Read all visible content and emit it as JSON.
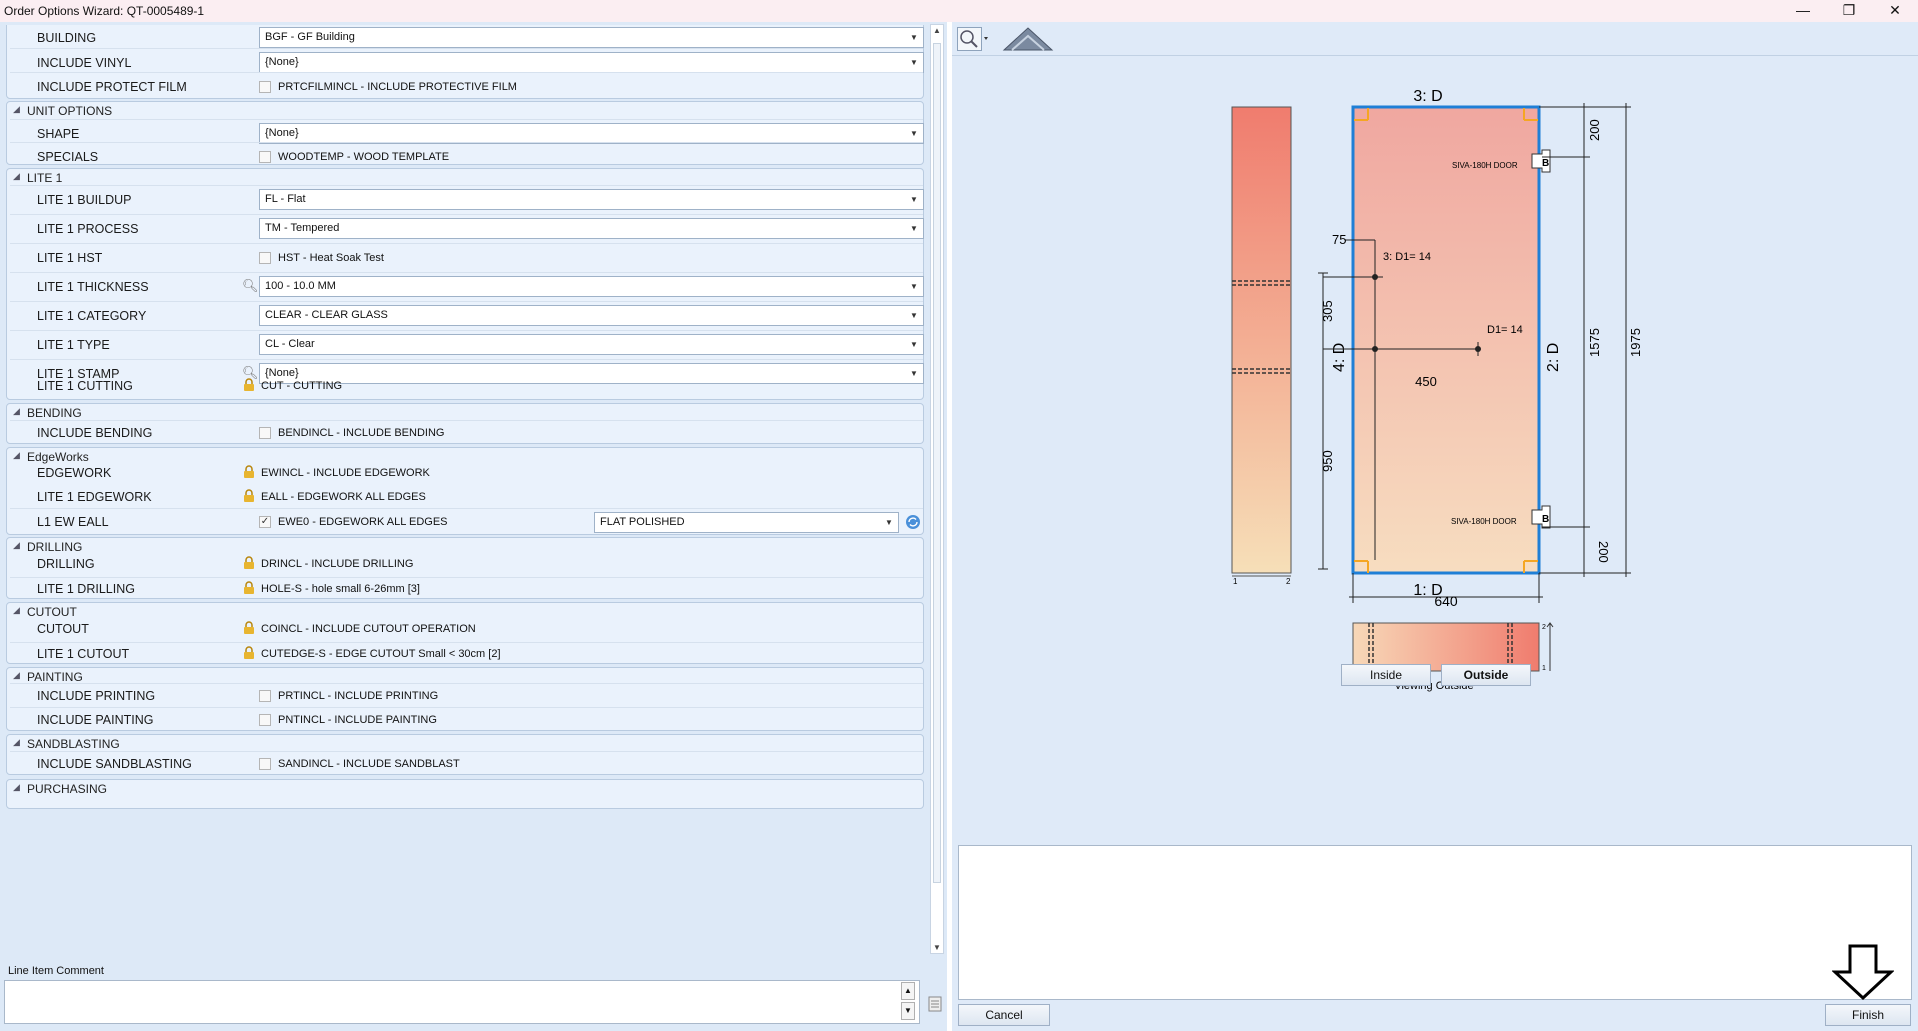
{
  "window": {
    "title": "Order Options Wizard: QT-0005489-1",
    "minimize": "—",
    "maximize": "❐",
    "close": "✕"
  },
  "sections": {
    "unit_options": "UNIT OPTIONS",
    "lite1": "LITE 1",
    "bending": "BENDING",
    "edgeworks": "EdgeWorks",
    "drilling": "DRILLING",
    "cutout": "CUTOUT",
    "painting": "PAINTING",
    "sandblasting": "SANDBLASTING",
    "purchasing": "PURCHASING"
  },
  "rows": {
    "building": {
      "label": "BUILDING",
      "value": "BGF - GF Building"
    },
    "include_vinyl": {
      "label": "INCLUDE VINYL",
      "value": "{None}"
    },
    "include_protect_film": {
      "label": "INCLUDE PROTECT FILM",
      "value": "PRTCFILMINCL - INCLUDE PROTECTIVE FILM",
      "checked": false
    },
    "shape": {
      "label": "SHAPE",
      "value": "{None}"
    },
    "specials": {
      "label": "SPECIALS",
      "value": "WOODTEMP - WOOD TEMPLATE",
      "checked": false
    },
    "lite1_buildup": {
      "label": "LITE 1 BUILDUP",
      "value": "FL - Flat"
    },
    "lite1_process": {
      "label": "LITE 1 PROCESS",
      "value": "TM - Tempered"
    },
    "lite1_hst": {
      "label": "LITE 1 HST",
      "value": "HST - Heat Soak Test",
      "checked": false
    },
    "lite1_thickness": {
      "label": "LITE 1 THICKNESS",
      "value": "100 - 10.0 MM"
    },
    "lite1_category": {
      "label": "LITE 1 CATEGORY",
      "value": "CLEAR - CLEAR GLASS"
    },
    "lite1_type": {
      "label": "LITE 1 TYPE",
      "value": "CL - Clear"
    },
    "lite1_stamp": {
      "label": "LITE 1 STAMP",
      "value": "{None}"
    },
    "lite1_cutting": {
      "label": "LITE 1 CUTTING",
      "value": "CUT - CUTTING"
    },
    "include_bending": {
      "label": "INCLUDE BENDING",
      "value": "BENDINCL - INCLUDE BENDING",
      "checked": false
    },
    "edgework": {
      "label": "EDGEWORK",
      "value": "EWINCL - INCLUDE EDGEWORK"
    },
    "lite1_edgework": {
      "label": "LITE 1 EDGEWORK",
      "value": "EALL - EDGEWORK ALL EDGES"
    },
    "l1_ew_eall": {
      "label": "L1 EW EALL",
      "value": "EWE0 - EDGEWORK ALL EDGES",
      "checked": true,
      "finish": "FLAT POLISHED"
    },
    "drilling": {
      "label": "DRILLING",
      "value": "DRINCL - INCLUDE DRILLING"
    },
    "lite1_drilling": {
      "label": "LITE 1 DRILLING",
      "value": "HOLE-S - hole small 6-26mm [3]"
    },
    "cutout": {
      "label": "CUTOUT",
      "value": "COINCL - INCLUDE CUTOUT OPERATION"
    },
    "lite1_cutout": {
      "label": "LITE 1 CUTOUT",
      "value": "CUTEDGE-S - EDGE CUTOUT Small < 30cm [2]"
    },
    "include_printing": {
      "label": "INCLUDE PRINTING",
      "value": "PRTINCL - INCLUDE PRINTING",
      "checked": false
    },
    "include_painting": {
      "label": "INCLUDE PAINTING",
      "value": "PNTINCL - INCLUDE PAINTING",
      "checked": false
    },
    "include_sandblasting": {
      "label": "INCLUDE SANDBLASTING",
      "value": "SANDINCL - INCLUDE SANDBLAST",
      "checked": false
    }
  },
  "comment": {
    "label": "Line Item Comment",
    "value": ""
  },
  "drawing": {
    "top_label": "3: D",
    "bottom_label": "1: D",
    "left_label": "4: D",
    "right_label": "2: D",
    "width_dim": "640",
    "height_dim": "1975",
    "inner_height_dim": "1575",
    "top_offset_dim": "200",
    "bottom_offset_dim": "200",
    "hole_x_dim": "75",
    "hole_y_dim": "305",
    "hole_y2_dim": "950",
    "hole_spacing_dim": "450",
    "hole_label_1": "3: D1= 14",
    "hole_label_2": "D1= 14",
    "hinge_label_top": "SIVA-180H DOOR",
    "hinge_label_bottom": "SIVA-180H DOOR",
    "hinge_letter": "B",
    "side_tick_left": "1",
    "side_tick_right": "2",
    "bar_tick_top": "2",
    "bar_tick_bottom": "1",
    "viewing_caption": "Viewing Outside"
  },
  "buttons": {
    "inside": "Inside",
    "outside": "Outside",
    "cancel": "Cancel",
    "finish": "Finish"
  },
  "colors": {
    "accent_blue": "#1f7fd6",
    "corner_orange": "#f5a623",
    "glass_top": "#f08a80",
    "glass_bottom": "#f7dcb5"
  }
}
